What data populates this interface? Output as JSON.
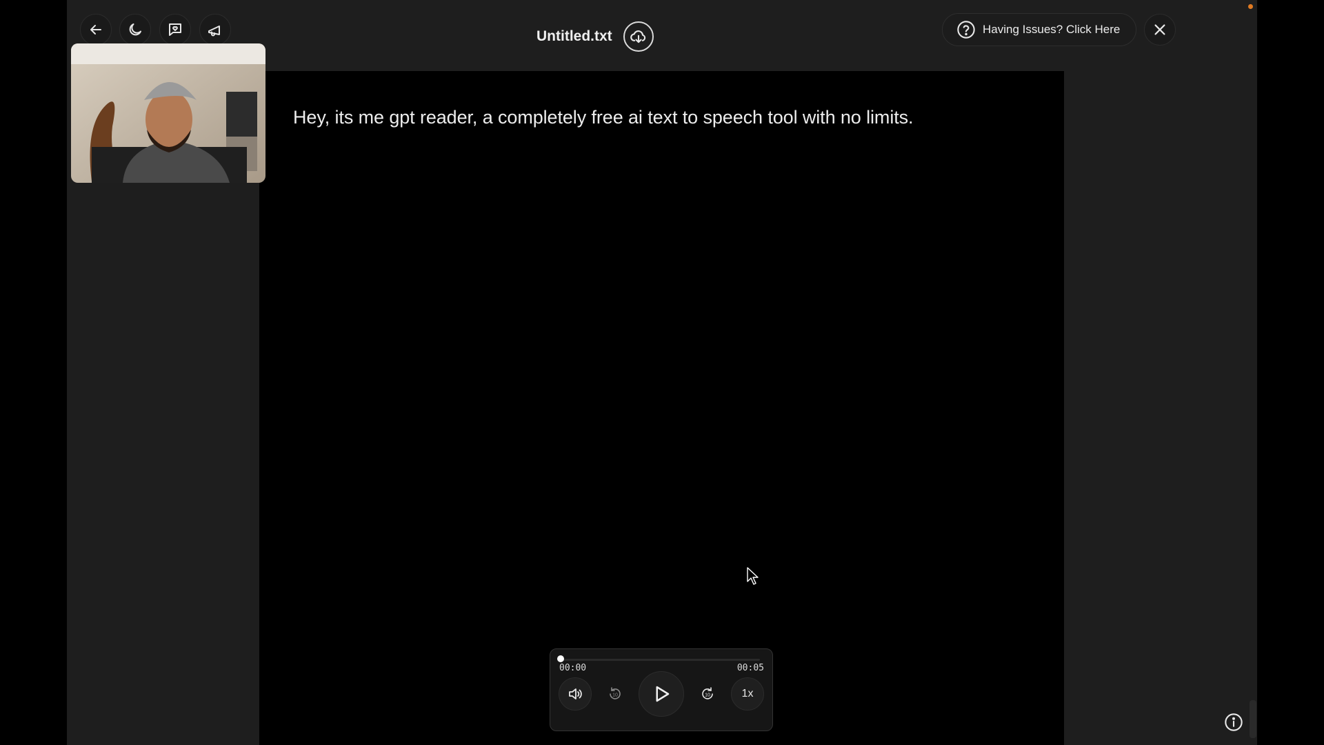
{
  "header": {
    "title": "Untitled.txt",
    "issues_label": "Having Issues? Click Here"
  },
  "document": {
    "text": "Hey, its me gpt reader, a completely free ai text to speech tool with no limits."
  },
  "player": {
    "current_time": "00:00",
    "total_time": "00:05",
    "progress": 0.0,
    "speed_label": "1x",
    "skip_back_seconds": "10",
    "skip_forward_seconds": "10"
  },
  "icons": {
    "back": "arrow-left-icon",
    "theme": "moon-icon",
    "feedback": "chat-heart-icon",
    "announce": "megaphone-icon",
    "save": "cloud-download-icon",
    "help": "question-circle-icon",
    "close": "close-icon",
    "info": "info-icon"
  },
  "colors": {
    "app_bg": "#1e1e1e",
    "document_bg": "#000000",
    "accent_dot": "#e07a22"
  }
}
